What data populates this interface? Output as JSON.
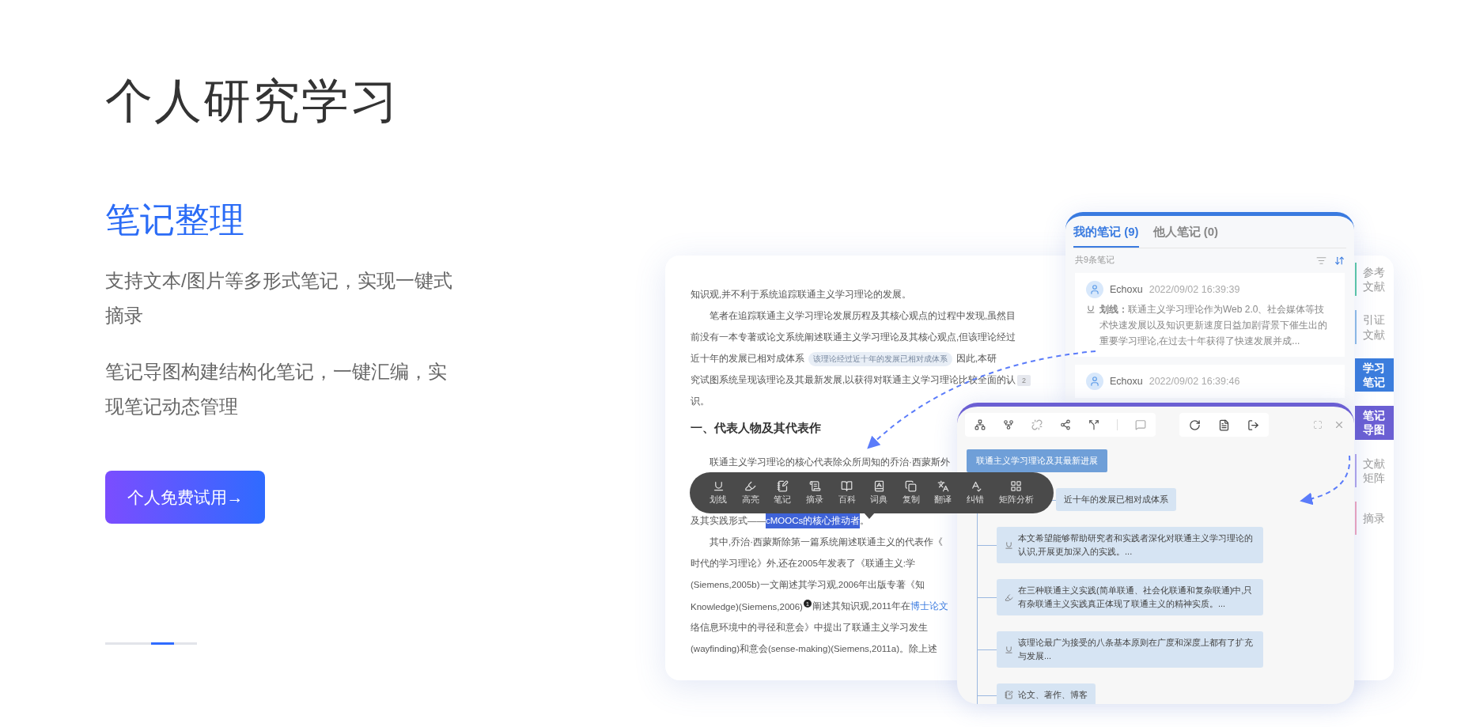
{
  "heading": "个人研究学习",
  "section": {
    "title": "笔记整理",
    "paragraphs": [
      "支持文本/图片等多形式笔记，实现一键式摘录",
      "笔记导图构建结构化笔记，一键汇编，实现笔记动态管理"
    ],
    "button": "个人免费试用→"
  },
  "carousel": [
    {
      "selected": false
    },
    {
      "selected": false
    },
    {
      "selected": true
    },
    {
      "selected": false
    }
  ],
  "document": {
    "lines": [
      {
        "kind": "line",
        "indent": false,
        "parts": [
          {
            "kind": "text",
            "text": "知识观,并不利于系统追踪联通主义学习理论的发展。"
          }
        ]
      },
      {
        "kind": "line",
        "indent": true,
        "parts": [
          {
            "kind": "text",
            "text": "笔者在追踪联通主义学习理论发展历程及其核心观点的过程中发现,虽然目"
          }
        ]
      },
      {
        "kind": "line",
        "indent": false,
        "parts": [
          {
            "kind": "text",
            "text": "前没有一本专著或论文系统阐述联通主义学习理论及其核心观点,但该理论经过"
          }
        ]
      },
      {
        "kind": "line",
        "indent": false,
        "parts": [
          {
            "kind": "text",
            "text": "近十年的发展已相对成体系"
          },
          {
            "kind": "tag",
            "text": "该理论经过近十年的发展已相对成体系"
          },
          {
            "kind": "text",
            "text": "因此,本研"
          }
        ]
      },
      {
        "kind": "line",
        "indent": false,
        "badge": "2",
        "parts": [
          {
            "kind": "text",
            "text": "究试图系统呈现该理论及其最新发展,以获得对联通主义学习理论比较全面的认"
          }
        ]
      },
      {
        "kind": "line",
        "indent": false,
        "parts": [
          {
            "kind": "text",
            "text": "识。"
          }
        ]
      },
      {
        "kind": "heading",
        "indent": false,
        "parts": [
          {
            "kind": "text",
            "text": "一、代表人物及其代表作"
          }
        ]
      },
      {
        "kind": "line",
        "indent": true,
        "parts": [
          {
            "kind": "text",
            "text": "联通主义学习理论的核心代表除众所周知的乔治·西蒙斯外"
          }
        ]
      },
      {
        "kind": "line",
        "indent": false,
        "parts": [
          {
            "kind": "text",
            "text": "及其实践形式——"
          },
          {
            "kind": "highlight",
            "text": "cMOOCs的核心推动者"
          },
          {
            "kind": "text",
            "text": "。"
          }
        ]
      },
      {
        "kind": "line",
        "indent": true,
        "parts": [
          {
            "kind": "text",
            "text": "其中,乔治·西蒙斯除第一篇系统阐述联通主义的代表作《"
          }
        ]
      },
      {
        "kind": "line",
        "indent": false,
        "parts": [
          {
            "kind": "text",
            "text": "时代的学习理论》外,还在2005年发表了《联通主义:学"
          }
        ]
      },
      {
        "kind": "line",
        "indent": false,
        "parts": [
          {
            "kind": "text",
            "text": "(Siemens,2005b)一文阐述其学习观,2006年出版专著《知"
          }
        ]
      },
      {
        "kind": "line",
        "indent": false,
        "parts": [
          {
            "kind": "text",
            "text": "Knowledge)(Siemens,2006)"
          },
          {
            "kind": "footnote",
            "text": "1"
          },
          {
            "kind": "text",
            "text": "阐述其知识观,2011年在"
          },
          {
            "kind": "link",
            "text": "博士论文"
          }
        ]
      },
      {
        "kind": "line",
        "indent": false,
        "parts": [
          {
            "kind": "text",
            "text": "络信息环境中的寻径和意会》中提出了联通主义学习发生"
          }
        ]
      },
      {
        "kind": "line",
        "indent": false,
        "parts": [
          {
            "kind": "text",
            "text": "(wayfinding)和意会(sense-making)(Siemens,2011a)。除上述"
          }
        ]
      }
    ]
  },
  "side_tabs": [
    {
      "label": "参考文献",
      "color": "#5cc9a7",
      "selected": false
    },
    {
      "label": "引证文献",
      "color": "#8fbde8",
      "selected": false
    },
    {
      "label": "学习笔记",
      "color": "#3b7ddd",
      "selected": true
    },
    {
      "label": "笔记导图",
      "color": "#6b5fd3",
      "selected": true
    },
    {
      "label": "文献矩阵",
      "color": "#b3a6ec",
      "selected": false
    },
    {
      "label": "摘录",
      "color": "#f2a7bf",
      "selected": false
    }
  ],
  "notes": {
    "tabs": [
      {
        "label": "我的笔记 (9)",
        "selected": true
      },
      {
        "label": "他人笔记 (0)",
        "selected": false
      }
    ],
    "count": "共9条笔记",
    "items": [
      {
        "author": "Echoxu",
        "time": "2022/09/02 16:39:39",
        "kind": "underline",
        "text": "**划线：**联通主义学习理论作为Web 2.0、社会媒体等技术快速发展以及知识更新速度日益加剧背景下催生出的重要学习理论,在过去十年获得了快速发展并成..."
      },
      {
        "author": "Echoxu",
        "time": "2022/09/02 16:39:46"
      }
    ]
  },
  "mindmap": {
    "root": "联通主义学习理论及其最新进展",
    "nodes": [
      {
        "kind": "none",
        "text": "近十年的发展已相对成体系"
      },
      {
        "kind": "underline",
        "text": "本文希望能够帮助研究者和实践者深化对联通主义学习理论的认识,开展更加深入的实践。..."
      },
      {
        "kind": "highlight",
        "text": "在三种联通主义实践(简单联通、社会化联通和复杂联通)中,只有杂联通主义实践真正体现了联通主义的精神实质。..."
      },
      {
        "kind": "underline",
        "text": "该理论最广为接受的八条基本原则在广度和深度上都有了扩充与发展..."
      },
      {
        "kind": "note",
        "text": "论文、著作、博客"
      }
    ]
  },
  "selection_toolbar": [
    {
      "kind": "underline",
      "label": "划线"
    },
    {
      "kind": "highlight",
      "label": "高亮"
    },
    {
      "kind": "note",
      "label": "笔记"
    },
    {
      "kind": "excerpt",
      "label": "摘录"
    },
    {
      "kind": "encyclopedia",
      "label": "百科"
    },
    {
      "kind": "dictionary",
      "label": "词典"
    },
    {
      "kind": "copy",
      "label": "复制"
    },
    {
      "kind": "translate",
      "label": "翻译"
    },
    {
      "kind": "correct",
      "label": "纠错"
    },
    {
      "kind": "matrix",
      "label": "矩阵分析"
    }
  ]
}
